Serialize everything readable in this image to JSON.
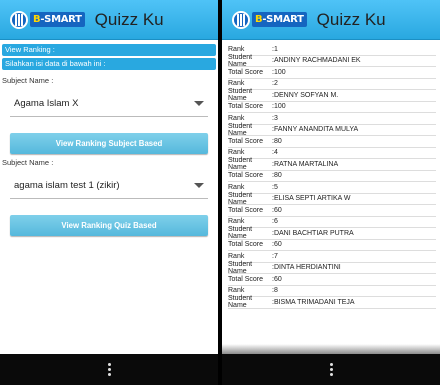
{
  "app": {
    "logo_prefix": "",
    "logo_letter": "B",
    "logo_word": "-SMART",
    "title": "Quizz Ku"
  },
  "left": {
    "banner1": "View Ranking :",
    "banner2": "Silahkan isi data di bawah ini :",
    "subject_label_1": "Subject Name :",
    "subject_value": "Agama Islam X",
    "button_subject": "View Ranking Subject Based",
    "subject_label_2": "Subject Name :",
    "quiz_value": "agama islam test 1 (zikir)",
    "button_quiz": "View Ranking Quiz Based"
  },
  "right": {
    "labels": {
      "rank": "Rank",
      "student": "Student Name",
      "score": "Total Score"
    },
    "entries": [
      {
        "rank": ":1",
        "name": ":ANDINY RACHMADANI EK",
        "score": ":100"
      },
      {
        "rank": ":2",
        "name": ":DENNY SOFYAN M.",
        "score": ":100"
      },
      {
        "rank": ":3",
        "name": ":FANNY ANANDITA MULYA",
        "score": ":80"
      },
      {
        "rank": ":4",
        "name": ":RATNA MARTALINA",
        "score": ":80"
      },
      {
        "rank": ":5",
        "name": ":ELISA SEPTI ARTIKA W",
        "score": ":60"
      },
      {
        "rank": ":6",
        "name": ":DANI BACHTIAR PUTRA",
        "score": ":60"
      },
      {
        "rank": ":7",
        "name": ":DINTA HERDIANTINI",
        "score": ":60"
      },
      {
        "rank": ":8",
        "name": ":BISMA TRIMADANI TEJA",
        "score": ""
      }
    ]
  }
}
